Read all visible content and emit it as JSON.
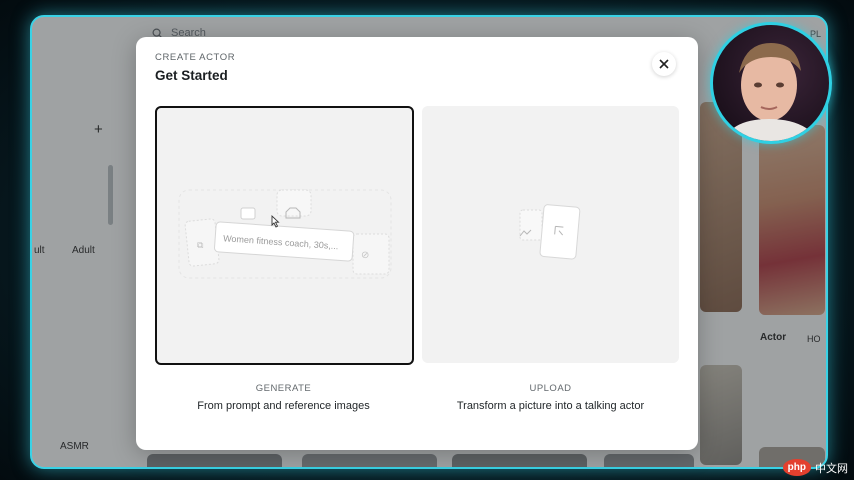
{
  "background": {
    "search_placeholder": "Search",
    "plus": "+",
    "categories": [
      "ult",
      "Adult",
      "ASMR"
    ],
    "right_header": "Actor",
    "right_header2": "HO",
    "right_top": "PL"
  },
  "modal": {
    "eyebrow": "CREATE ACTOR",
    "title": "Get Started",
    "close_label": "×",
    "options": [
      {
        "label": "GENERATE",
        "description": "From prompt and reference images",
        "preview_text": "Women fitness coach, 30s,..."
      },
      {
        "label": "UPLOAD",
        "description": "Transform a picture into a talking actor"
      }
    ]
  },
  "watermark": {
    "brand": "php",
    "text": "中文网"
  },
  "colors": {
    "accent": "#39d2e6",
    "selected_border": "#111111"
  }
}
